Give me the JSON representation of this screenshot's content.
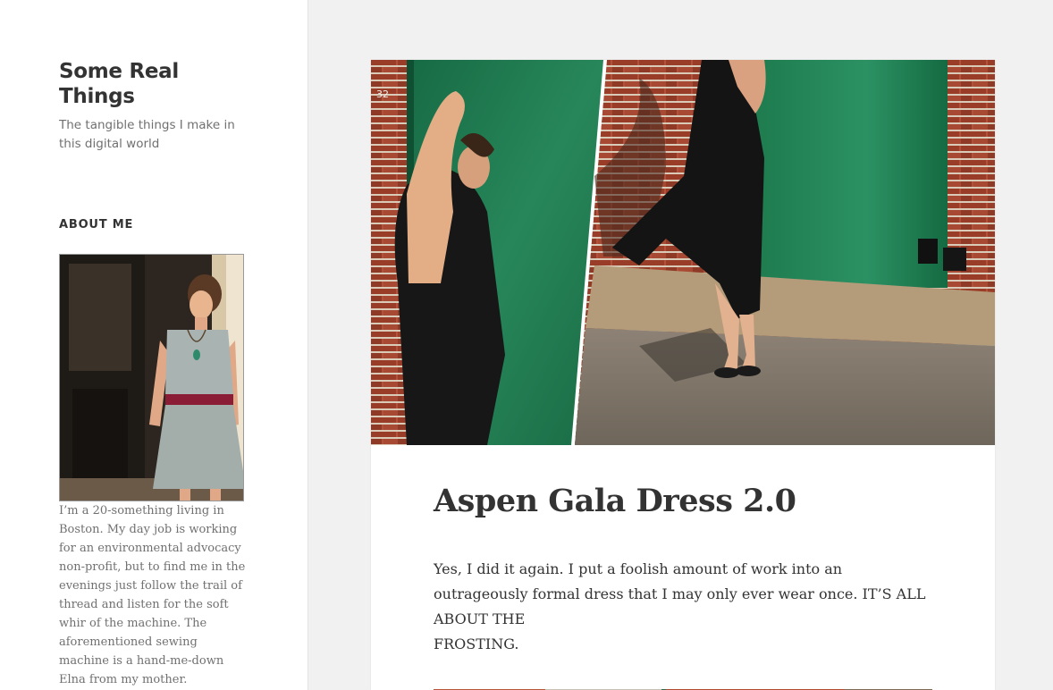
{
  "site": {
    "title": "Some Real Things",
    "description": "The tangible things I make in this digital world"
  },
  "widget": {
    "title": "ABOUT ME",
    "bio": "I’m a 20-something living in Boston. My day job is working for an environmental advocacy non-profit, but to find me in the evenings just follow the trail of thread and listen for the soft whir of the machine. The aforementioned sewing machine is a hand-me-down Elna from my mother."
  },
  "post": {
    "title": "Aspen Gala Dress 2.0",
    "paragraph_lines": [
      "Yes, I did it again. I put a foolish amount of work into an",
      "outrageously formal dress that I may only ever wear once. IT’S ALL",
      "ABOUT THE",
      "FROSTING."
    ]
  },
  "colors": {
    "sidebar_bg": "#ffffff",
    "page_bg": "#f1f1f1",
    "text": "#333333",
    "muted": "#707070",
    "door_green": "#1f7a4d",
    "brick": "#a0412b"
  }
}
